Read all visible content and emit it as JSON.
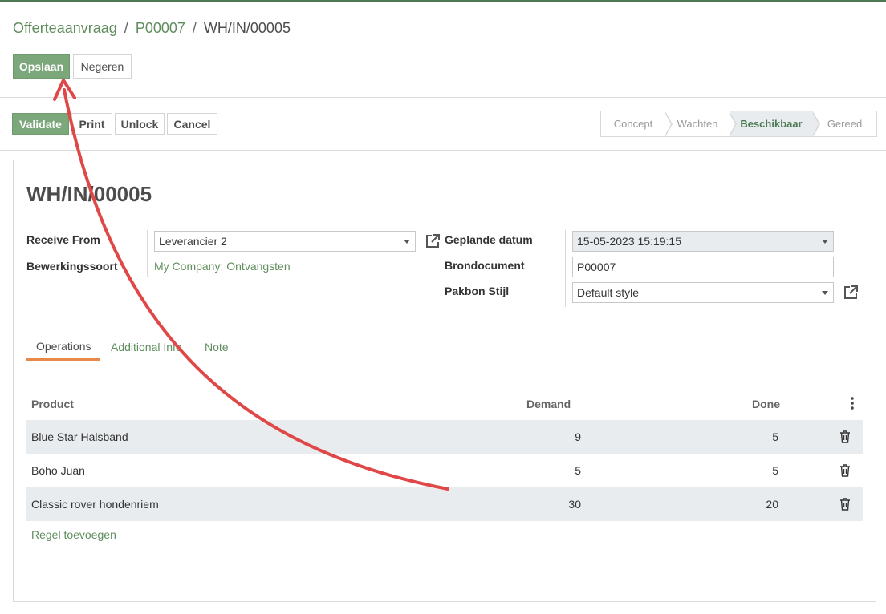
{
  "breadcrumb": {
    "items": [
      "Offerteaanvraag",
      "P00007"
    ],
    "separator": "/",
    "current": "WH/IN/00005"
  },
  "edit_buttons": {
    "save": "Opslaan",
    "discard": "Negeren"
  },
  "action_buttons": {
    "validate": "Validate",
    "print": "Print",
    "unlock": "Unlock",
    "cancel": "Cancel"
  },
  "status_bar": {
    "stages": [
      "Concept",
      "Wachten",
      "Beschikbaar",
      "Gereed"
    ],
    "active": "Beschikbaar"
  },
  "record": {
    "title": "WH/IN/00005",
    "receive_from_label": "Receive From",
    "receive_from_value": "Leverancier 2",
    "operation_type_label": "Bewerkingssoort",
    "operation_type_value": "My Company: Ontvangsten",
    "scheduled_date_label": "Geplande datum",
    "scheduled_date_value": "15-05-2023 15:19:15",
    "source_doc_label": "Brondocument",
    "source_doc_value": "P00007",
    "slip_style_label": "Pakbon Stijl",
    "slip_style_value": "Default style"
  },
  "tabs": [
    "Operations",
    "Additional Info",
    "Note"
  ],
  "active_tab": "Operations",
  "table": {
    "headers": {
      "product": "Product",
      "demand": "Demand",
      "done": "Done"
    },
    "rows": [
      {
        "product": "Blue Star Halsband",
        "demand": "9",
        "done": "5"
      },
      {
        "product": "Boho Juan",
        "demand": "5",
        "done": "5"
      },
      {
        "product": "Classic rover hondenriem",
        "demand": "30",
        "done": "20"
      }
    ],
    "add_line": "Regel toevoegen"
  },
  "colors": {
    "primary": "#7ba77a",
    "link": "#5f8d5d",
    "tab_accent": "#e8894a",
    "annotation_arrow": "#e04848"
  },
  "icons": {
    "external_link": "external-link-icon",
    "trash": "trash-icon",
    "kebab": "vertical-dots-icon",
    "dropdown": "caret-down-icon"
  }
}
